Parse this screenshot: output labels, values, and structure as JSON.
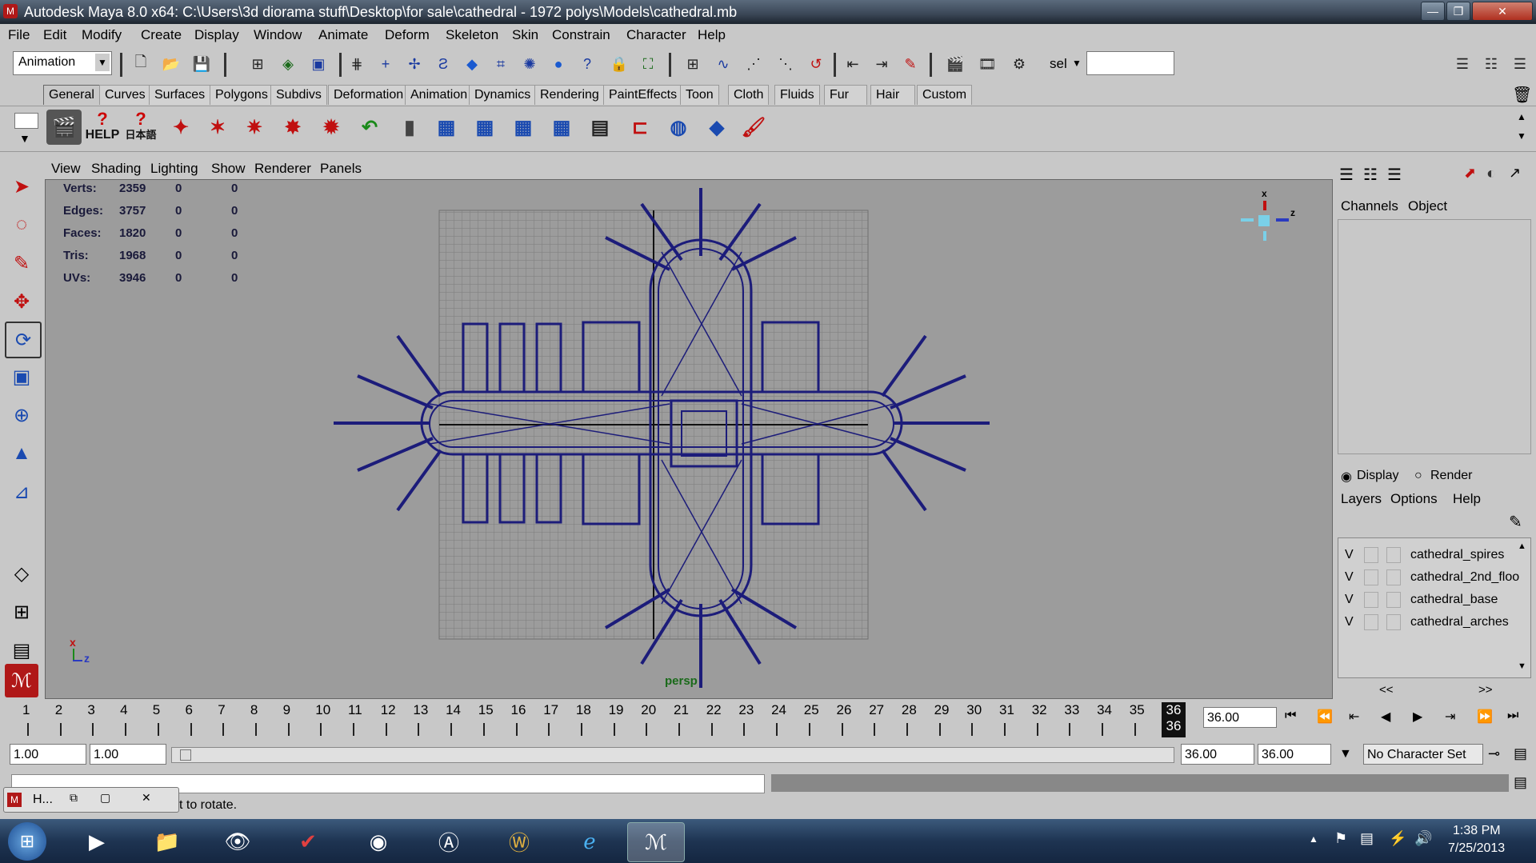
{
  "window": {
    "title": "Autodesk Maya 8.0 x64: C:\\Users\\3d diorama stuff\\Desktop\\for sale\\cathedral - 1972 polys\\Models\\cathedral.mb",
    "min": "—",
    "max": "❐",
    "close": "✕"
  },
  "menus": [
    "File",
    "Edit",
    "Modify",
    "Create",
    "Display",
    "Window",
    "Animate",
    "Deform",
    "Skeleton",
    "Skin",
    "Constrain",
    "Character",
    "Help"
  ],
  "status": {
    "mode": "Animation",
    "sel_label": "sel",
    "sel_value": ""
  },
  "shelf_tabs": [
    "General",
    "Curves",
    "Surfaces",
    "Polygons",
    "Subdivs",
    "Deformation",
    "Animation",
    "Dynamics",
    "Rendering",
    "PaintEffects",
    "Toon",
    "Cloth",
    "Fluids",
    "Fur",
    "Hair",
    "Custom"
  ],
  "shelf_help": "HELP",
  "shelf_help_jp": "日本語",
  "panel_menus": [
    "View",
    "Shading",
    "Lighting",
    "Show",
    "Renderer",
    "Panels"
  ],
  "hud": {
    "rows": [
      {
        "label": "Verts:",
        "v1": "2359",
        "v2": "0",
        "v3": "0"
      },
      {
        "label": "Edges:",
        "v1": "3757",
        "v2": "0",
        "v3": "0"
      },
      {
        "label": "Faces:",
        "v1": "1820",
        "v2": "0",
        "v3": "0"
      },
      {
        "label": "Tris:",
        "v1": "1968",
        "v2": "0",
        "v3": "0"
      },
      {
        "label": "UVs:",
        "v1": "3946",
        "v2": "0",
        "v3": "0"
      }
    ],
    "camera": "persp",
    "axis_x": "x",
    "axis_z": "z"
  },
  "channel_box": {
    "tab1": "Channels",
    "tab2": "Object"
  },
  "layer_editor": {
    "display": "Display",
    "render": "Render",
    "menus": [
      "Layers",
      "Options",
      "Help"
    ],
    "layers": [
      {
        "vis": "V",
        "name": "cathedral_spires"
      },
      {
        "vis": "V",
        "name": "cathedral_2nd_floo"
      },
      {
        "vis": "V",
        "name": "cathedral_base"
      },
      {
        "vis": "V",
        "name": "cathedral_arches"
      }
    ],
    "prev": "<<",
    "next": ">>"
  },
  "timeline": {
    "frames": [
      "1",
      "2",
      "3",
      "4",
      "5",
      "6",
      "7",
      "8",
      "9",
      "10",
      "11",
      "12",
      "13",
      "14",
      "15",
      "16",
      "17",
      "18",
      "19",
      "20",
      "21",
      "22",
      "23",
      "24",
      "25",
      "26",
      "27",
      "28",
      "29",
      "30",
      "31",
      "32",
      "33",
      "34",
      "35"
    ],
    "current_top": "36",
    "current_bottom": "36",
    "current_value": "36.00"
  },
  "range": {
    "start": "1.00",
    "playback_start": "1.00",
    "playback_end": "36.00",
    "end": "36.00",
    "character_set": "No Character Set"
  },
  "help_line": "t to rotate.",
  "minimized_window": "H...",
  "clock": {
    "time": "1:38 PM",
    "date": "7/25/2013"
  },
  "colors": {
    "wire": "#1c1c7a",
    "viewport": "#9c9c9c",
    "ui": "#c8c8c8"
  }
}
